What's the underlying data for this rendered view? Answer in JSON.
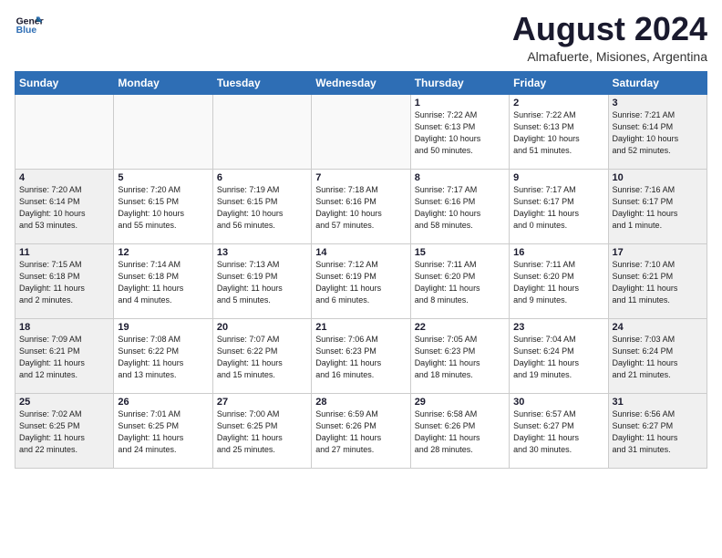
{
  "logo": {
    "line1": "General",
    "line2": "Blue"
  },
  "title": "August 2024",
  "subtitle": "Almafuerte, Misiones, Argentina",
  "weekdays": [
    "Sunday",
    "Monday",
    "Tuesday",
    "Wednesday",
    "Thursday",
    "Friday",
    "Saturday"
  ],
  "weeks": [
    [
      {
        "day": "",
        "info": ""
      },
      {
        "day": "",
        "info": ""
      },
      {
        "day": "",
        "info": ""
      },
      {
        "day": "",
        "info": ""
      },
      {
        "day": "1",
        "info": "Sunrise: 7:22 AM\nSunset: 6:13 PM\nDaylight: 10 hours\nand 50 minutes."
      },
      {
        "day": "2",
        "info": "Sunrise: 7:22 AM\nSunset: 6:13 PM\nDaylight: 10 hours\nand 51 minutes."
      },
      {
        "day": "3",
        "info": "Sunrise: 7:21 AM\nSunset: 6:14 PM\nDaylight: 10 hours\nand 52 minutes."
      }
    ],
    [
      {
        "day": "4",
        "info": "Sunrise: 7:20 AM\nSunset: 6:14 PM\nDaylight: 10 hours\nand 53 minutes."
      },
      {
        "day": "5",
        "info": "Sunrise: 7:20 AM\nSunset: 6:15 PM\nDaylight: 10 hours\nand 55 minutes."
      },
      {
        "day": "6",
        "info": "Sunrise: 7:19 AM\nSunset: 6:15 PM\nDaylight: 10 hours\nand 56 minutes."
      },
      {
        "day": "7",
        "info": "Sunrise: 7:18 AM\nSunset: 6:16 PM\nDaylight: 10 hours\nand 57 minutes."
      },
      {
        "day": "8",
        "info": "Sunrise: 7:17 AM\nSunset: 6:16 PM\nDaylight: 10 hours\nand 58 minutes."
      },
      {
        "day": "9",
        "info": "Sunrise: 7:17 AM\nSunset: 6:17 PM\nDaylight: 11 hours\nand 0 minutes."
      },
      {
        "day": "10",
        "info": "Sunrise: 7:16 AM\nSunset: 6:17 PM\nDaylight: 11 hours\nand 1 minute."
      }
    ],
    [
      {
        "day": "11",
        "info": "Sunrise: 7:15 AM\nSunset: 6:18 PM\nDaylight: 11 hours\nand 2 minutes."
      },
      {
        "day": "12",
        "info": "Sunrise: 7:14 AM\nSunset: 6:18 PM\nDaylight: 11 hours\nand 4 minutes."
      },
      {
        "day": "13",
        "info": "Sunrise: 7:13 AM\nSunset: 6:19 PM\nDaylight: 11 hours\nand 5 minutes."
      },
      {
        "day": "14",
        "info": "Sunrise: 7:12 AM\nSunset: 6:19 PM\nDaylight: 11 hours\nand 6 minutes."
      },
      {
        "day": "15",
        "info": "Sunrise: 7:11 AM\nSunset: 6:20 PM\nDaylight: 11 hours\nand 8 minutes."
      },
      {
        "day": "16",
        "info": "Sunrise: 7:11 AM\nSunset: 6:20 PM\nDaylight: 11 hours\nand 9 minutes."
      },
      {
        "day": "17",
        "info": "Sunrise: 7:10 AM\nSunset: 6:21 PM\nDaylight: 11 hours\nand 11 minutes."
      }
    ],
    [
      {
        "day": "18",
        "info": "Sunrise: 7:09 AM\nSunset: 6:21 PM\nDaylight: 11 hours\nand 12 minutes."
      },
      {
        "day": "19",
        "info": "Sunrise: 7:08 AM\nSunset: 6:22 PM\nDaylight: 11 hours\nand 13 minutes."
      },
      {
        "day": "20",
        "info": "Sunrise: 7:07 AM\nSunset: 6:22 PM\nDaylight: 11 hours\nand 15 minutes."
      },
      {
        "day": "21",
        "info": "Sunrise: 7:06 AM\nSunset: 6:23 PM\nDaylight: 11 hours\nand 16 minutes."
      },
      {
        "day": "22",
        "info": "Sunrise: 7:05 AM\nSunset: 6:23 PM\nDaylight: 11 hours\nand 18 minutes."
      },
      {
        "day": "23",
        "info": "Sunrise: 7:04 AM\nSunset: 6:24 PM\nDaylight: 11 hours\nand 19 minutes."
      },
      {
        "day": "24",
        "info": "Sunrise: 7:03 AM\nSunset: 6:24 PM\nDaylight: 11 hours\nand 21 minutes."
      }
    ],
    [
      {
        "day": "25",
        "info": "Sunrise: 7:02 AM\nSunset: 6:25 PM\nDaylight: 11 hours\nand 22 minutes."
      },
      {
        "day": "26",
        "info": "Sunrise: 7:01 AM\nSunset: 6:25 PM\nDaylight: 11 hours\nand 24 minutes."
      },
      {
        "day": "27",
        "info": "Sunrise: 7:00 AM\nSunset: 6:25 PM\nDaylight: 11 hours\nand 25 minutes."
      },
      {
        "day": "28",
        "info": "Sunrise: 6:59 AM\nSunset: 6:26 PM\nDaylight: 11 hours\nand 27 minutes."
      },
      {
        "day": "29",
        "info": "Sunrise: 6:58 AM\nSunset: 6:26 PM\nDaylight: 11 hours\nand 28 minutes."
      },
      {
        "day": "30",
        "info": "Sunrise: 6:57 AM\nSunset: 6:27 PM\nDaylight: 11 hours\nand 30 minutes."
      },
      {
        "day": "31",
        "info": "Sunrise: 6:56 AM\nSunset: 6:27 PM\nDaylight: 11 hours\nand 31 minutes."
      }
    ]
  ]
}
